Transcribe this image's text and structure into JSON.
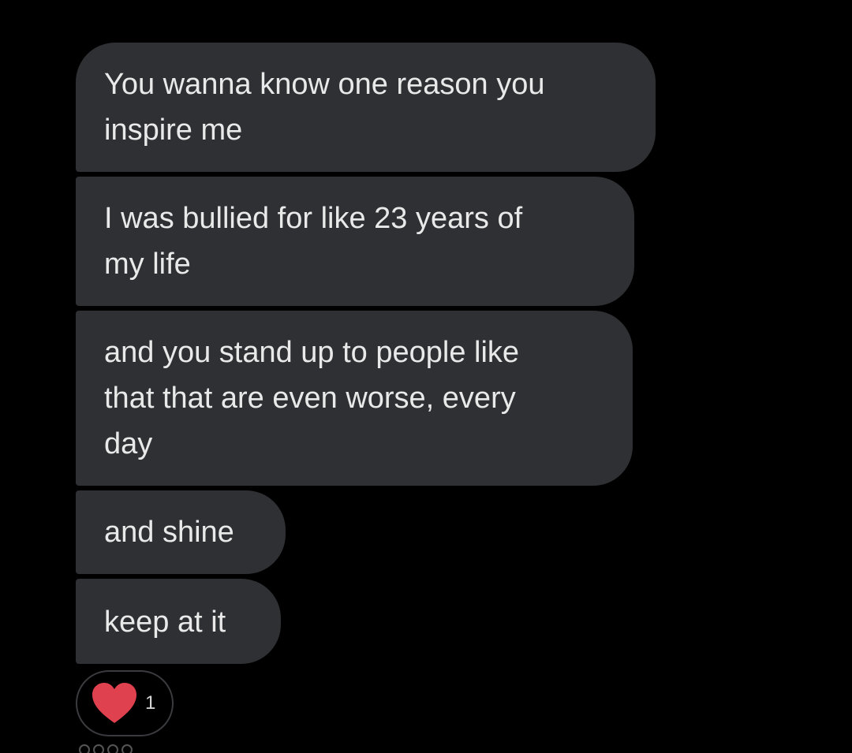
{
  "conversation": {
    "messages": [
      {
        "lines": [
          "You wanna know one reason you",
          "inspire me"
        ]
      },
      {
        "lines": [
          "I was bullied for like 23 years of",
          "my life"
        ]
      },
      {
        "lines": [
          "and you stand up to people like",
          "that that are even worse, every",
          "day"
        ]
      },
      {
        "lines": [
          "and shine"
        ]
      },
      {
        "lines": [
          "keep at it"
        ]
      }
    ],
    "reaction": {
      "icon": "heart-icon",
      "count": "1",
      "color": "#e0414f"
    }
  },
  "theme": {
    "background": "#000000",
    "bubble": "#2f3033",
    "text": "#e9e9ea"
  }
}
